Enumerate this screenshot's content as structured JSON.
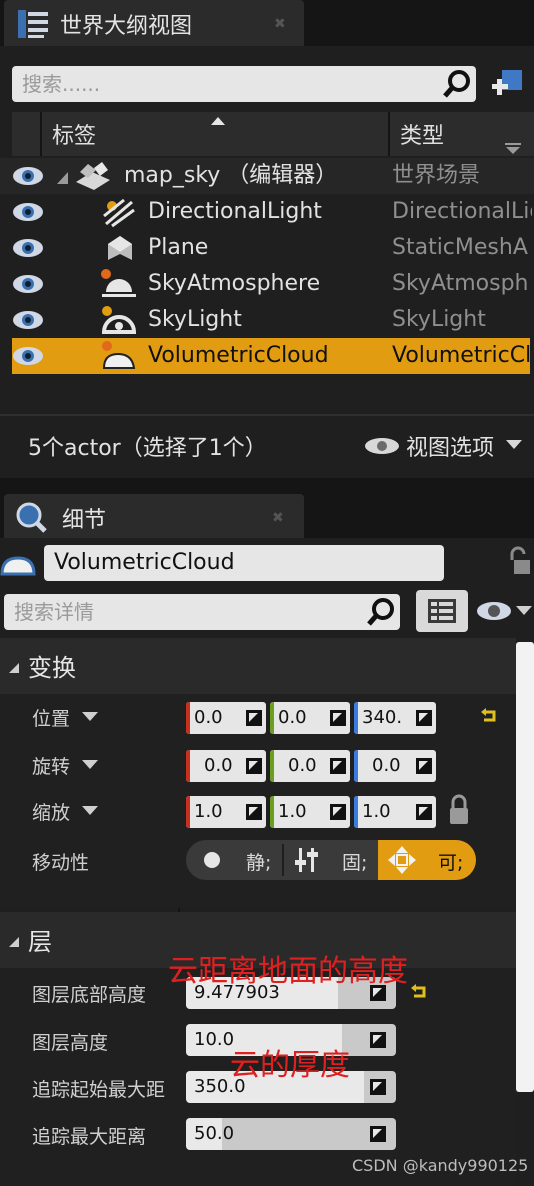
{
  "outliner": {
    "tab_title": "世界大纲视图",
    "search_placeholder": "搜索......",
    "col_label": "标签",
    "col_type": "类型",
    "rows": [
      {
        "label": "map_sky （编辑器）",
        "type": "世界场景"
      },
      {
        "label": "DirectionalLight",
        "type": "DirectionalLig"
      },
      {
        "label": "Plane",
        "type": "StaticMeshA"
      },
      {
        "label": "SkyAtmosphere",
        "type": "SkyAtmosph"
      },
      {
        "label": "SkyLight",
        "type": "SkyLight"
      },
      {
        "label": "VolumetricCloud",
        "type": "VolumetricCl"
      }
    ],
    "status": "5个actor（选择了1个）",
    "view_options": "视图选项"
  },
  "details": {
    "tab_title": "细节",
    "actor_name": "VolumetricCloud",
    "search_placeholder": "搜索详情",
    "transform": {
      "title": "变换",
      "location_label": "位置",
      "location": [
        "0.0",
        "0.0",
        "340."
      ],
      "rotation_label": "旋转",
      "rotation": [
        "0.0",
        "0.0",
        "0.0"
      ],
      "scale_label": "缩放",
      "scale": [
        "1.0",
        "1.0",
        "1.0"
      ],
      "mobility_label": "移动性",
      "mobility_options": [
        "静;",
        "固;",
        "可;"
      ]
    },
    "layer": {
      "title": "层",
      "bottom_altitude_label": "图层底部高度",
      "bottom_altitude": "9.477903",
      "height_label": "图层高度",
      "height": "10.0",
      "trace_start_label": "追踪起始最大距",
      "trace_start": "350.0",
      "trace_max_label": "追踪最大距离",
      "trace_max": "50.0"
    }
  },
  "annotations": {
    "cloud_altitude": "云距离地面的高度",
    "cloud_thickness": "云的厚度"
  },
  "watermark": "CSDN @kandy990125",
  "colors": {
    "selection": "#e29c11",
    "x_axis": "#c8301e",
    "y_axis": "#6aa020",
    "z_axis": "#3a7be0"
  }
}
